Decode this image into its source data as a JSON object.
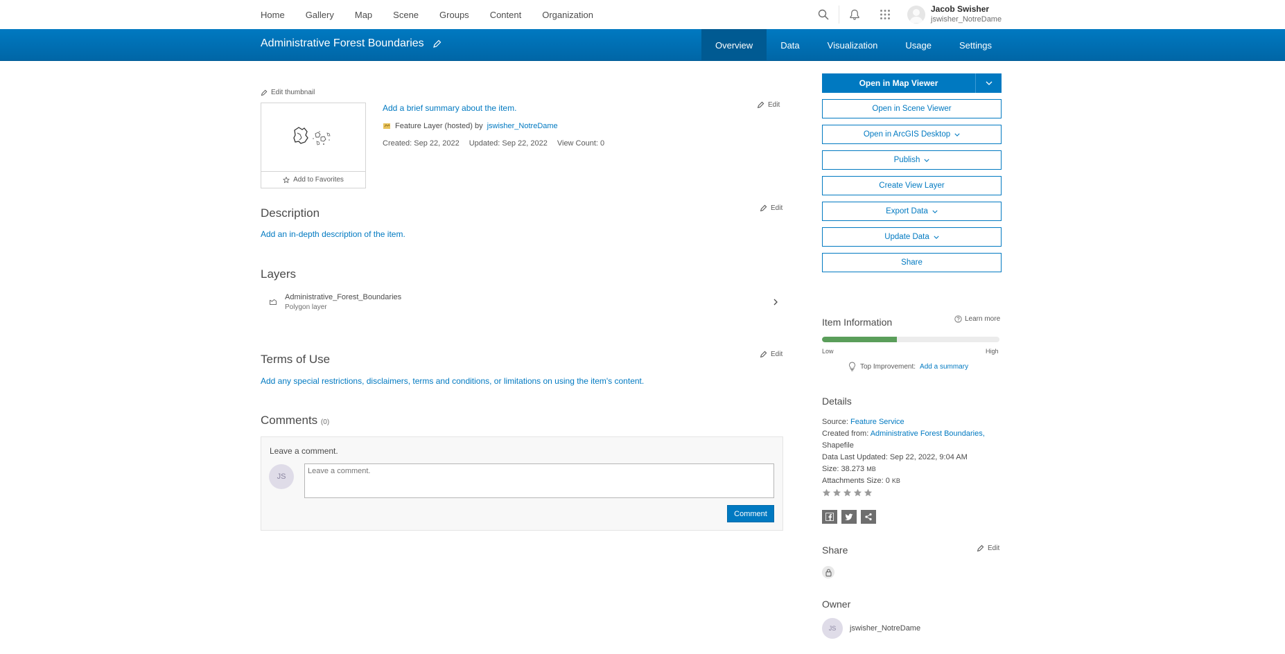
{
  "topnav": {
    "links": [
      "Home",
      "Gallery",
      "Map",
      "Scene",
      "Groups",
      "Content",
      "Organization"
    ],
    "user_name": "Jacob Swisher",
    "user_handle": "jswisher_NotreDame"
  },
  "titlebar": {
    "title": "Administrative Forest Boundaries",
    "tabs": [
      "Overview",
      "Data",
      "Visualization",
      "Usage",
      "Settings"
    ],
    "active_tab": "Overview"
  },
  "item": {
    "edit_thumbnail": "Edit thumbnail",
    "add_favorites": "Add to Favorites",
    "summary_link": "Add a brief summary about the item.",
    "type_text": "Feature Layer (hosted) by",
    "owner_link": "jswisher_NotreDame",
    "created": "Created: Sep 22, 2022",
    "updated": "Updated: Sep 22, 2022",
    "view_count": "View Count: 0",
    "edit_label": "Edit"
  },
  "description": {
    "heading": "Description",
    "link": "Add an in-depth description of the item."
  },
  "layers": {
    "heading": "Layers",
    "items": [
      {
        "name": "Administrative_Forest_Boundaries",
        "type": "Polygon layer"
      }
    ]
  },
  "terms": {
    "heading": "Terms of Use",
    "link": "Add any special restrictions, disclaimers, terms and conditions, or limitations on using the item's content."
  },
  "comments": {
    "heading": "Comments",
    "count": "(0)",
    "leave_label": "Leave a comment.",
    "placeholder": "Leave a comment.",
    "avatar_initials": "JS",
    "button": "Comment"
  },
  "actions": {
    "open_map_viewer": "Open in Map Viewer",
    "open_scene_viewer": "Open in Scene Viewer",
    "open_desktop": "Open in ArcGIS Desktop",
    "publish": "Publish",
    "create_view_layer": "Create View Layer",
    "export_data": "Export Data",
    "update_data": "Update Data",
    "share": "Share"
  },
  "item_info": {
    "heading": "Item Information",
    "learn_more": "Learn more",
    "score": 0.42,
    "low": "Low",
    "high": "High",
    "top_improvement_label": "Top Improvement:",
    "top_improvement_link": "Add a summary"
  },
  "details": {
    "heading": "Details",
    "source_label": "Source:",
    "source_value": "Feature Service",
    "created_from_label": "Created from:",
    "created_from_value": "Administrative Forest Boundaries,",
    "created_from_extra": "Shapefile",
    "data_last_updated": "Data Last Updated: Sep 22, 2022, 9:04 AM",
    "size_label": "Size: 38.273",
    "size_unit": "MB",
    "attachments_label": "Attachments Size: 0",
    "attachments_unit": "KB",
    "rating": 0
  },
  "share_section": {
    "heading": "Share",
    "edit_label": "Edit"
  },
  "owner_section": {
    "heading": "Owner",
    "initials": "JS",
    "name": "jswisher_NotreDame"
  },
  "colors": {
    "brand_blue": "#0079c1",
    "meter_green": "#5a9e5a"
  }
}
